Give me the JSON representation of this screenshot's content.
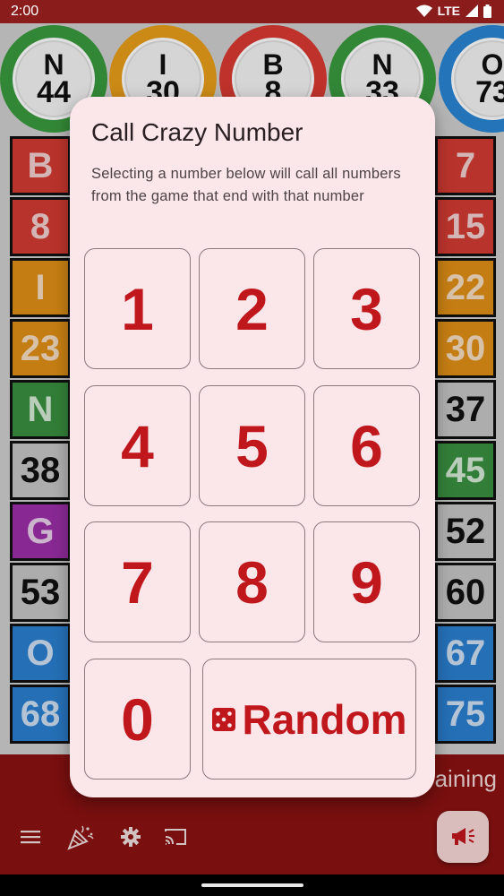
{
  "status_bar": {
    "time": "2:00",
    "network": "LTE"
  },
  "called_balls": [
    {
      "letter": "N",
      "number": "44",
      "color": "#3a9a3e"
    },
    {
      "letter": "I",
      "number": "30",
      "color": "#e89c1a"
    },
    {
      "letter": "B",
      "number": "8",
      "color": "#d93a32"
    },
    {
      "letter": "N",
      "number": "33",
      "color": "#3a9a3e"
    },
    {
      "letter": "O",
      "number": "73",
      "color": "#2a84d4"
    }
  ],
  "left_board": [
    {
      "text": "B",
      "bg": "#d23b32",
      "fg": "#f2cfcf"
    },
    {
      "text": "8",
      "bg": "#d23b32",
      "fg": "#f2cfcf"
    },
    {
      "text": "I",
      "bg": "#e08f16",
      "fg": "#f5dcc0"
    },
    {
      "text": "23",
      "bg": "#e08f16",
      "fg": "#f5dcc0"
    },
    {
      "text": "N",
      "bg": "#3a9040",
      "fg": "#d4ead4"
    },
    {
      "text": "38",
      "bg": "#c5c5c5",
      "fg": "#111111"
    },
    {
      "text": "G",
      "bg": "#9b2fa8",
      "fg": "#e8cfea"
    },
    {
      "text": "53",
      "bg": "#c5c5c5",
      "fg": "#111111"
    },
    {
      "text": "O",
      "bg": "#2b7fd0",
      "fg": "#cfe0f2"
    },
    {
      "text": "68",
      "bg": "#2b7fd0",
      "fg": "#cfe0f2"
    }
  ],
  "right_board": [
    {
      "text": "7",
      "bg": "#d23b32",
      "fg": "#f2cfcf"
    },
    {
      "text": "15",
      "bg": "#d23b32",
      "fg": "#f2cfcf"
    },
    {
      "text": "22",
      "bg": "#e08f16",
      "fg": "#f5dcc0"
    },
    {
      "text": "30",
      "bg": "#e08f16",
      "fg": "#f5dcc0"
    },
    {
      "text": "37",
      "bg": "#c5c5c5",
      "fg": "#111111"
    },
    {
      "text": "45",
      "bg": "#3a9040",
      "fg": "#d4ead4"
    },
    {
      "text": "52",
      "bg": "#c5c5c5",
      "fg": "#111111"
    },
    {
      "text": "60",
      "bg": "#c5c5c5",
      "fg": "#111111"
    },
    {
      "text": "67",
      "bg": "#2b7fd0",
      "fg": "#cfe0f2"
    },
    {
      "text": "75",
      "bg": "#2b7fd0",
      "fg": "#cfe0f2"
    }
  ],
  "bottom_bar": {
    "remaining_text": "aining",
    "nav_icons": [
      "menu-icon",
      "party-popper-icon",
      "gear-icon",
      "cast-icon"
    ],
    "fab_icon": "megaphone-icon"
  },
  "dialog": {
    "title": "Call Crazy Number",
    "description": "Selecting a number below will call all numbers from the game that end with that number",
    "keys": [
      "1",
      "2",
      "3",
      "4",
      "5",
      "6",
      "7",
      "8",
      "9",
      "0"
    ],
    "random_label": "Random",
    "accent_color": "#c0171d"
  }
}
